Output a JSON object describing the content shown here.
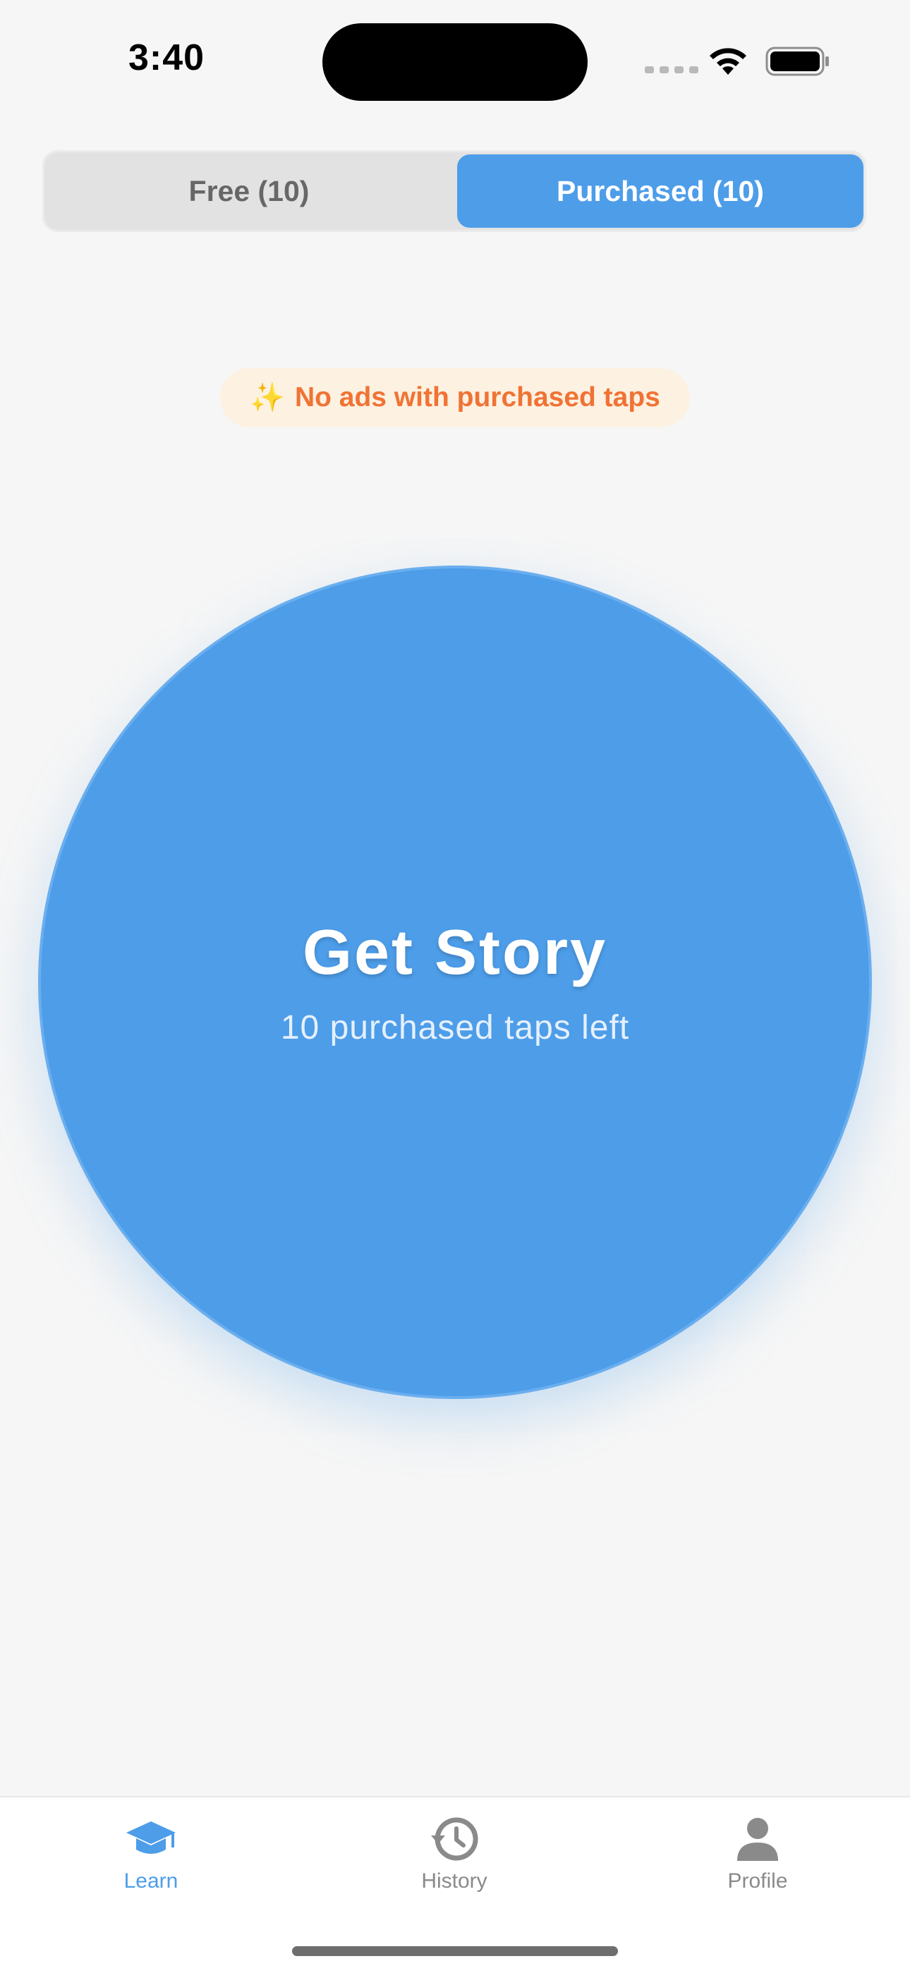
{
  "status_bar": {
    "time": "3:40"
  },
  "segmented_control": {
    "free_label": "Free (10)",
    "purchased_label": "Purchased (10)",
    "selected": "purchased"
  },
  "notice": {
    "icon": "sparkles-icon",
    "text": "No ads with purchased taps"
  },
  "story_button": {
    "title": "Get Story",
    "subtitle": "10 purchased taps left"
  },
  "tab_bar": {
    "tabs": [
      {
        "label": "Learn",
        "icon": "graduation-cap-icon",
        "active": true
      },
      {
        "label": "History",
        "icon": "history-clock-icon",
        "active": false
      },
      {
        "label": "Profile",
        "icon": "person-icon",
        "active": false
      }
    ]
  },
  "colors": {
    "accent": "#4d9de9",
    "inactive": "#8a8a8a",
    "notice_text": "#f07334",
    "notice_bg": "#fdf1e1",
    "background": "#f6f6f6"
  }
}
